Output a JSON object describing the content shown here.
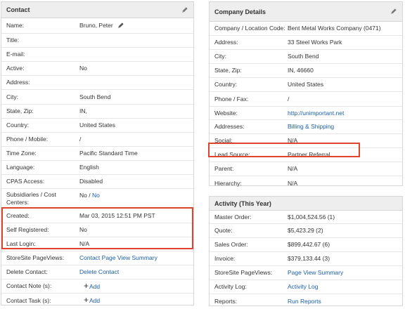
{
  "contact": {
    "title": "Contact",
    "rows": [
      {
        "label": "Name:",
        "value": "Bruno, Peter"
      },
      {
        "label": "Title:",
        "value": ""
      },
      {
        "label": "E-mail:",
        "value": ""
      },
      {
        "label": "Active:",
        "value": "No"
      },
      {
        "label": "Address:",
        "value": ""
      },
      {
        "label": "City:",
        "value": "South Bend"
      },
      {
        "label": "State, Zip:",
        "value": "IN,"
      },
      {
        "label": "Country:",
        "value": "United States"
      },
      {
        "label": "Phone / Mobile:",
        "value": "/"
      },
      {
        "label": "Time Zone:",
        "value": "Pacific Standard Time"
      },
      {
        "label": "Language:",
        "value": "English"
      },
      {
        "label": "CPAS Access:",
        "value": "Disabled"
      },
      {
        "label": "Subsidiaries / Cost Centers:",
        "value_prefix": "No / ",
        "value_link": "No"
      },
      {
        "label": "Created:",
        "value": "Mar 03, 2015 12:51 PM PST"
      },
      {
        "label": "Self Registered:",
        "value": "No"
      },
      {
        "label": "Last Login:",
        "value": "N/A"
      },
      {
        "label": "StoreSite PageViews:",
        "value": "Contact Page View Summary"
      },
      {
        "label": "Delete Contact:",
        "value": "Delete Contact"
      },
      {
        "label": "Contact Note (s):",
        "plus": "+",
        "value": "Add"
      },
      {
        "label": "Contact Task (s):",
        "plus": "+",
        "value": "Add"
      }
    ]
  },
  "company": {
    "title": "Company Details",
    "rows": [
      {
        "label": "Company / Location Code:",
        "value": "Bent Metal Works Company (0471)"
      },
      {
        "label": "Address:",
        "value": "33 Steel Works Park"
      },
      {
        "label": "City:",
        "value": "South Bend"
      },
      {
        "label": "State, Zip:",
        "value": "IN, 46660"
      },
      {
        "label": "Country:",
        "value": "United States"
      },
      {
        "label": "Phone / Fax:",
        "value": "/"
      },
      {
        "label": "Website:",
        "value": "http://unimportant.net"
      },
      {
        "label": "Addresses:",
        "value": "Billing & Shipping"
      },
      {
        "label": "Social:",
        "value": "N/A"
      },
      {
        "label": "Lead Source:",
        "value": "Partner Referral"
      },
      {
        "label": "Parent:",
        "value": "N/A"
      },
      {
        "label": "Hierarchy:",
        "value": "N/A"
      }
    ]
  },
  "activity": {
    "title": "Activity (This Year)",
    "rows": [
      {
        "label": "Master Order:",
        "value": "$1,004,524.56 (1)"
      },
      {
        "label": "Quote:",
        "value": "$5,423.29 (2)"
      },
      {
        "label": "Sales Order:",
        "value": "$899,442.67 (6)"
      },
      {
        "label": "Invoice:",
        "value": "$379,133.44 (3)"
      },
      {
        "label": "StoreSite PageViews:",
        "value": "Page View Summary"
      },
      {
        "label": "Activity Log:",
        "value": "Activity Log"
      },
      {
        "label": "Reports:",
        "value": "Run Reports"
      }
    ]
  },
  "colors": {
    "highlight": "#e0442d",
    "link": "#1a5fa8",
    "header_bg": "#eeeeee"
  },
  "icons": {
    "edit": "pencil-icon"
  }
}
